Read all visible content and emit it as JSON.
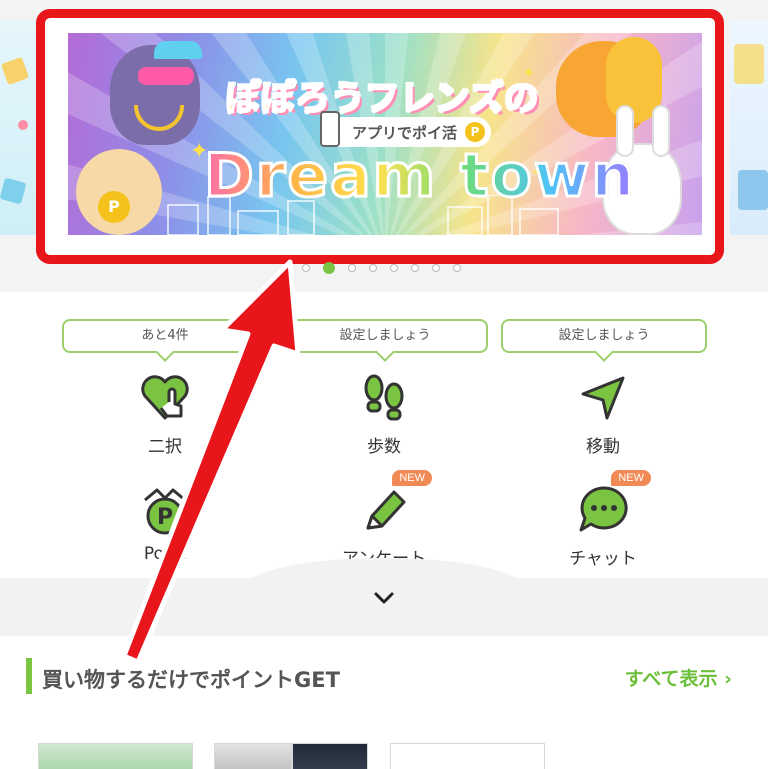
{
  "banner": {
    "title_jp": "ぽぽろうフレンズの",
    "pill_text": "アプリでポイ活",
    "coin_letter": "P",
    "dream_text": "Dream town"
  },
  "carousel": {
    "dot_count": 8,
    "active_index": 1
  },
  "menu": {
    "bubbles": [
      "あと4件",
      "設定しましょう",
      "設定しましょう"
    ],
    "items": [
      {
        "label": "二択",
        "icon": "heart-hand-icon",
        "new": false
      },
      {
        "label": "歩数",
        "icon": "footprints-icon",
        "new": false
      },
      {
        "label": "移動",
        "icon": "navigation-arrow-icon",
        "new": false
      },
      {
        "label": "Point",
        "icon": "point-coin-icon",
        "new": false
      },
      {
        "label": "アンケート",
        "icon": "pencil-icon",
        "new": true
      },
      {
        "label": "チャット",
        "icon": "chat-bubble-icon",
        "new": true
      }
    ],
    "new_badge": "NEW"
  },
  "section": {
    "title": "買い物するだけでポイントGET",
    "see_all": "すべて表示 ›"
  },
  "colors": {
    "accent_green": "#7bc442",
    "annotation_red": "#e8161b",
    "new_badge": "#f28a55"
  }
}
